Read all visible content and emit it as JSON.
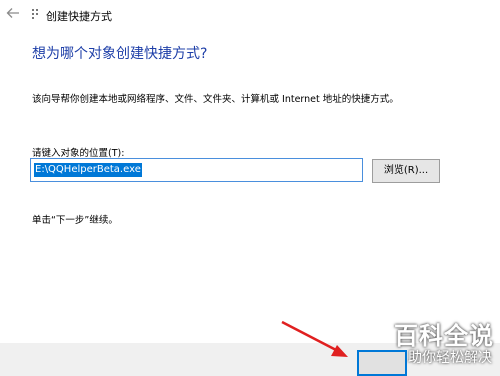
{
  "window": {
    "title": "创建快捷方式"
  },
  "heading": "想为哪个对象创建快捷方式?",
  "description": "该向导帮你创建本地或网络程序、文件、文件夹、计算机或 Internet 地址的快捷方式。",
  "location": {
    "label": "请键入对象的位置(T):",
    "value": "E:\\QQHelperBeta.exe"
  },
  "browse_label": "浏览(R)...",
  "hint": "单击“下一步”继续。",
  "watermark": {
    "main": "百科全说",
    "sub": "助你轻松解决"
  },
  "colors": {
    "heading": "#1e3fa8",
    "selection": "#0078d7",
    "arrow": "#e02020"
  },
  "icons": {
    "back": "back-arrow-icon",
    "wizard": "wizard-icon"
  }
}
